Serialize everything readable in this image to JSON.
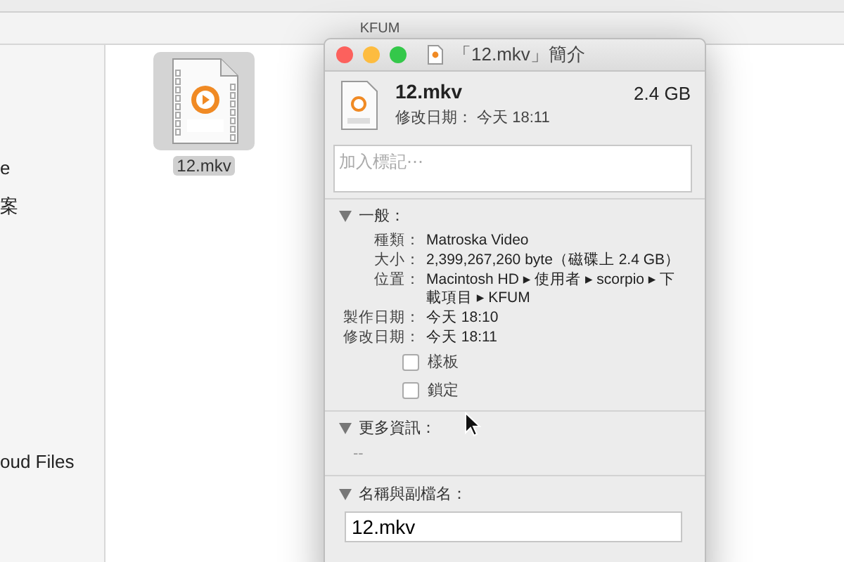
{
  "finder": {
    "path_title": "KFUM",
    "sidebar_items": [
      "e",
      "案",
      "oud Files"
    ],
    "file": {
      "name": "12.mkv",
      "selected": true
    }
  },
  "info": {
    "title": "「12.mkv」簡介",
    "name": "12.mkv",
    "size": "2.4 GB",
    "modified": "修改日期： 今天 18:11",
    "tags": {
      "placeholder": "加入標記⋯"
    },
    "general": {
      "title": "一般：",
      "expanded": true,
      "rows": [
        {
          "label": "種類：",
          "value": "Matroska Video"
        },
        {
          "label": "大小：",
          "value": "2,399,267,260 byte（磁碟上 2.4 GB）"
        },
        {
          "label": "位置：",
          "value": "Macintosh HD ▸ 使用者 ▸ scorpio ▸ 下載項目 ▸ KFUM"
        },
        {
          "label": "製作日期：",
          "value": "今天 18:10"
        },
        {
          "label": "修改日期：",
          "value": "今天 18:11"
        }
      ],
      "checkboxes": [
        {
          "label": "樣板",
          "checked": false
        },
        {
          "label": "鎖定",
          "checked": false
        }
      ]
    },
    "more_info": {
      "title": "更多資訊：",
      "expanded": true,
      "text": "--"
    },
    "name_ext": {
      "title": "名稱與副檔名：",
      "expanded": true,
      "value": "12.mkv"
    }
  }
}
